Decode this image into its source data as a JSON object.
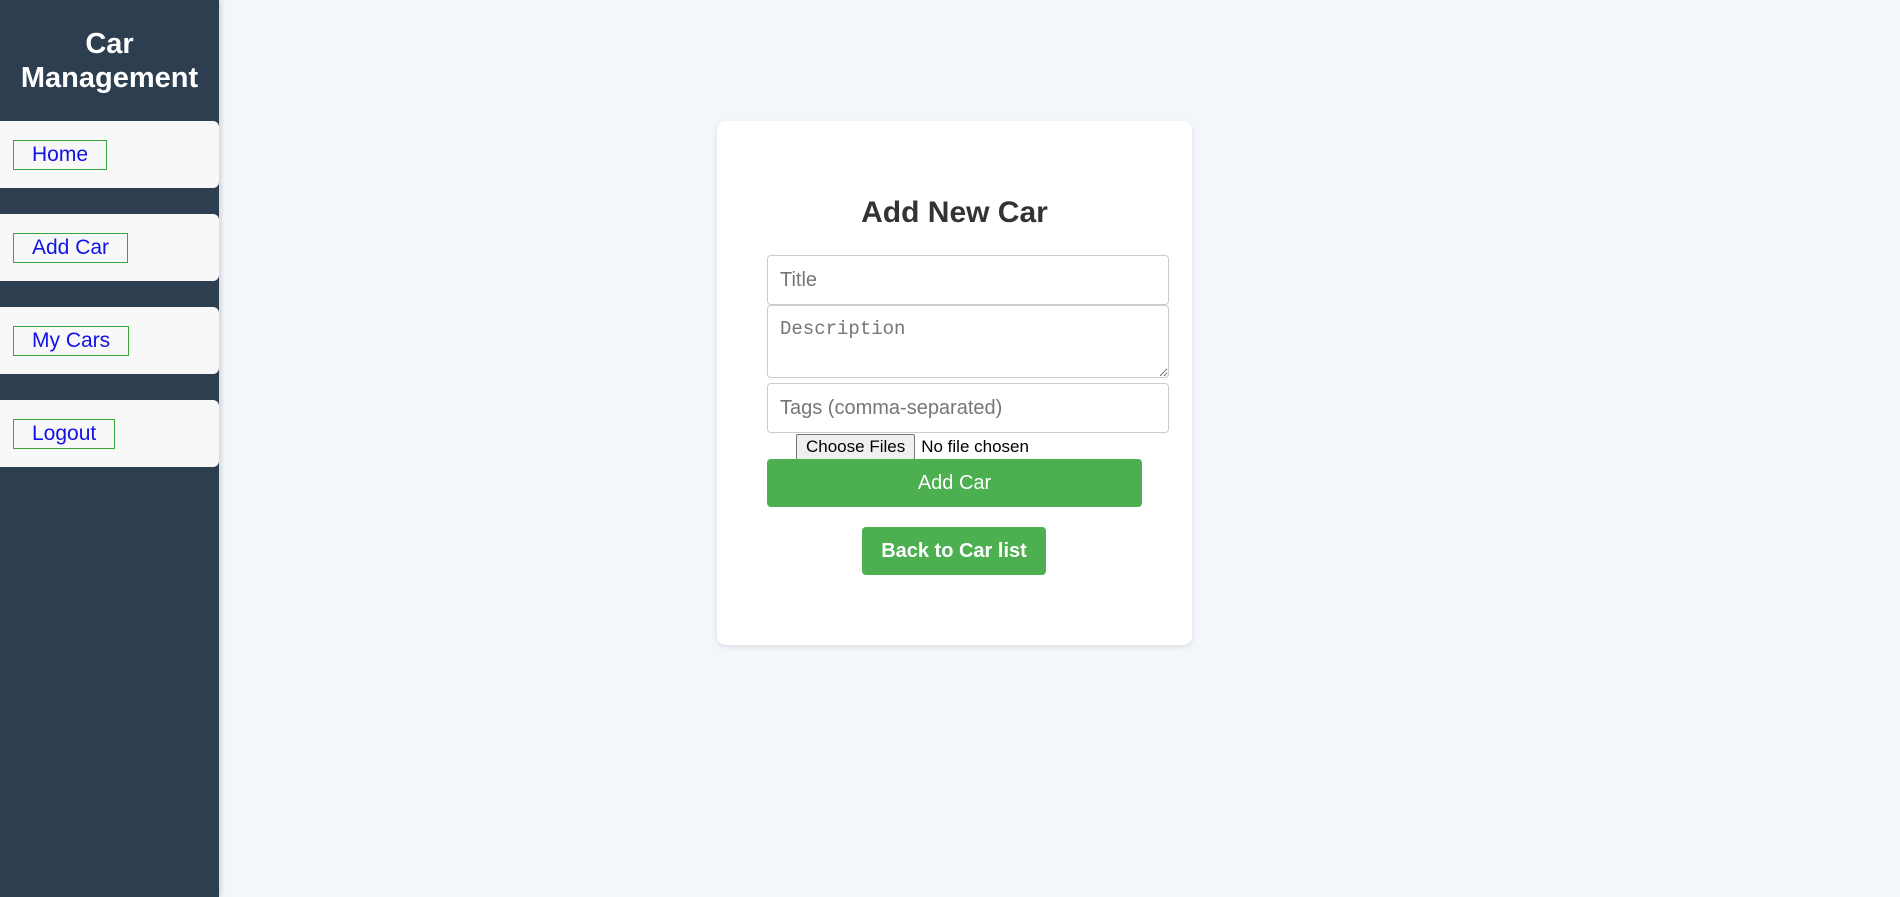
{
  "sidebar": {
    "brand": "Car Management",
    "items": [
      {
        "label": "Home"
      },
      {
        "label": "Add Car"
      },
      {
        "label": "My Cars"
      },
      {
        "label": "Logout"
      }
    ]
  },
  "form": {
    "heading": "Add New Car",
    "title_placeholder": "Title",
    "description_placeholder": "Description",
    "tags_placeholder": "Tags (comma-separated)",
    "file_button": "Choose Files",
    "file_status": "No file chosen",
    "submit_label": "Add Car",
    "back_label": "Back to Car list"
  },
  "colors": {
    "sidebar_bg": "#2c3e50",
    "accent": "#4caf50",
    "link": "#1212e6",
    "page_bg": "#f3f6fa"
  }
}
